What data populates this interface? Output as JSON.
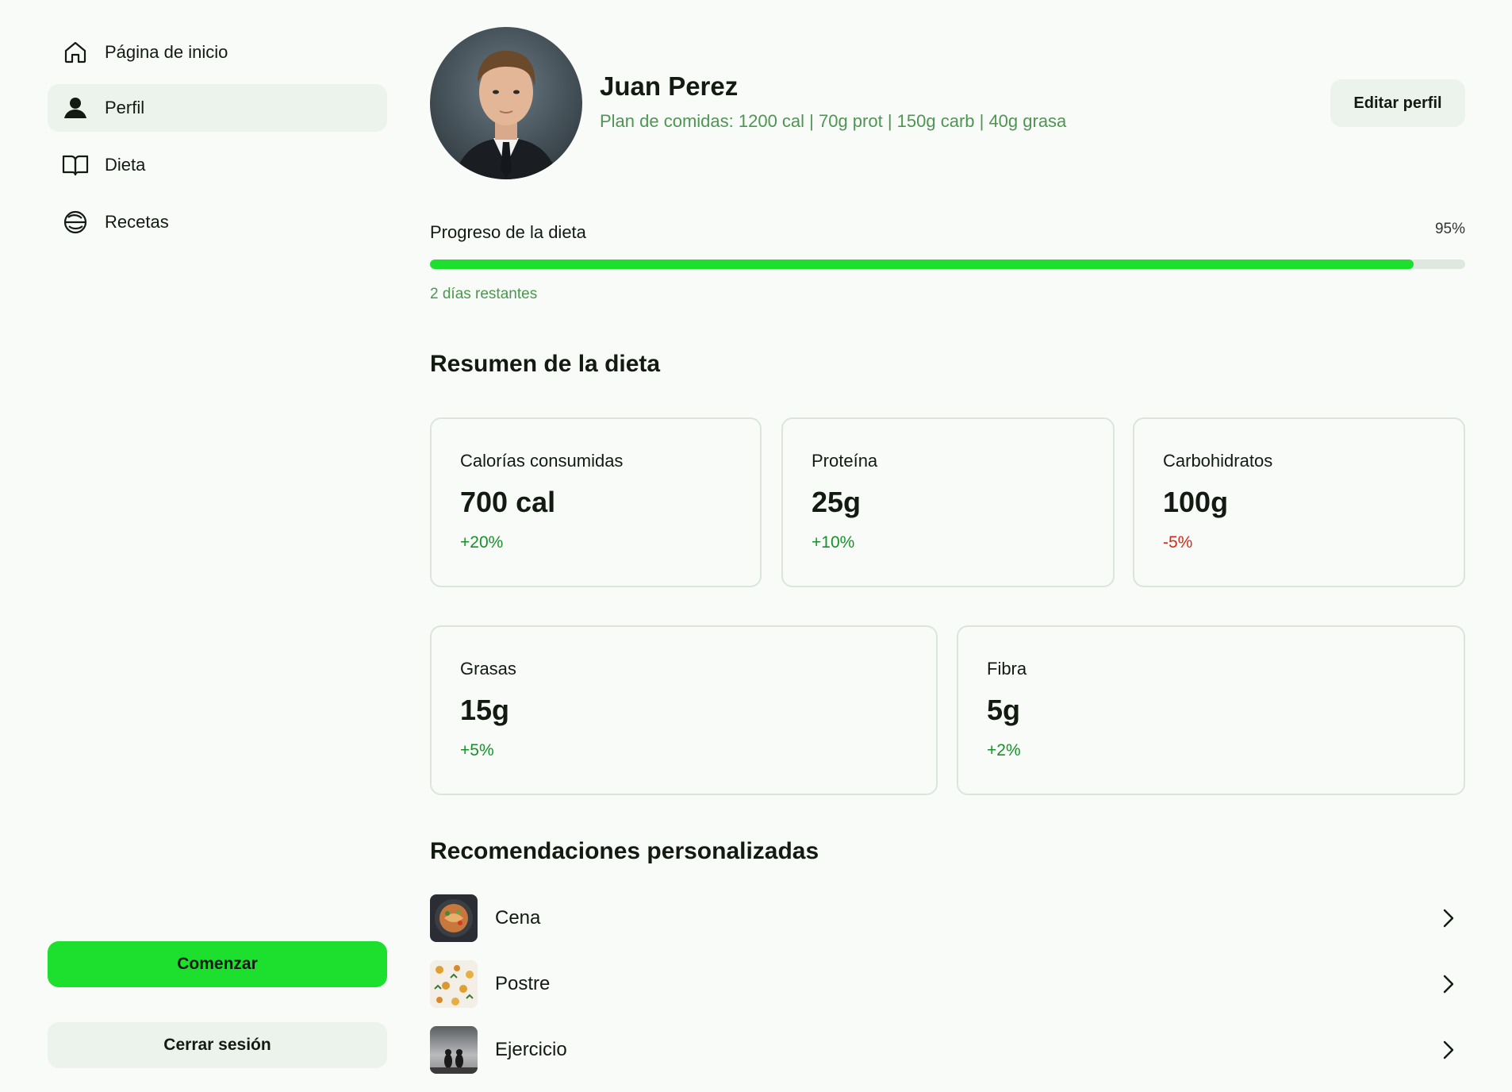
{
  "sidebar": {
    "items": [
      {
        "label": "Página de inicio",
        "icon": "home-icon"
      },
      {
        "label": "Perfil",
        "icon": "user-icon",
        "active": true
      },
      {
        "label": "Dieta",
        "icon": "book-icon"
      },
      {
        "label": "Recetas",
        "icon": "bowl-icon"
      }
    ],
    "start_label": "Comenzar",
    "logout_label": "Cerrar sesión"
  },
  "profile": {
    "name": "Juan Perez",
    "plan": "Plan de comidas: 1200 cal | 70g prot | 150g carb | 40g grasa",
    "edit_label": "Editar perfil"
  },
  "progress": {
    "label": "Progreso de la dieta",
    "percent_text": "95%",
    "value": 0.95,
    "remaining": "2 días restantes"
  },
  "summary": {
    "title": "Resumen de la dieta",
    "cards": [
      {
        "label": "Calorías consumidas",
        "value": "700 cal",
        "delta": "+20%"
      },
      {
        "label": "Proteína",
        "value": "25g",
        "delta": "+10%"
      },
      {
        "label": "Carbohidratos",
        "value": "100g",
        "delta": "-5%"
      },
      {
        "label": "Grasas",
        "value": "15g",
        "delta": "+5%"
      },
      {
        "label": "Fibra",
        "value": "5g",
        "delta": "+2%"
      }
    ]
  },
  "recommendations": {
    "title": "Recomendaciones personalizadas",
    "items": [
      {
        "label": "Cena",
        "icon": "dinner-thumbnail"
      },
      {
        "label": "Postre",
        "icon": "dessert-thumbnail"
      },
      {
        "label": "Ejercicio",
        "icon": "exercise-thumbnail"
      }
    ]
  },
  "colors": {
    "accent": "#1ddf2e",
    "positive": "#17922a",
    "negative": "#d12c1a",
    "muted_green": "#4d9651",
    "surface": "#ecf3ec"
  }
}
